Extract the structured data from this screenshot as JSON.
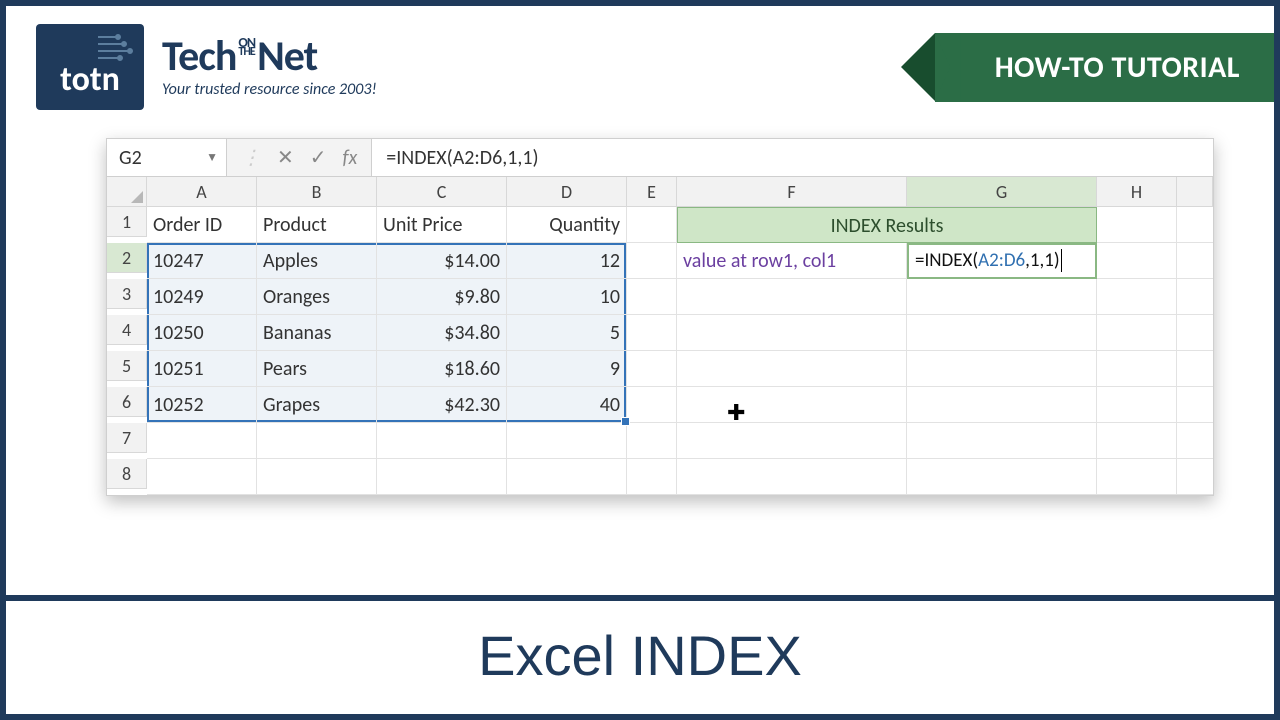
{
  "logo": {
    "box": "totn",
    "brand_pre": "Tech",
    "brand_on1": "ON",
    "brand_on2": "THE",
    "brand_post": "Net",
    "tagline": "Your trusted resource since 2003!"
  },
  "ribbon": {
    "label": "HOW-TO TUTORIAL"
  },
  "excel": {
    "namebox": "G2",
    "formula": "=INDEX(A2:D6,1,1)",
    "fx_label": "fx",
    "cols": [
      "A",
      "B",
      "C",
      "D",
      "E",
      "F",
      "G",
      "H"
    ],
    "rows": [
      "1",
      "2",
      "3",
      "4",
      "5",
      "6",
      "7",
      "8"
    ],
    "headers": {
      "A": "Order ID",
      "B": "Product",
      "C": "Unit Price",
      "D": "Quantity"
    },
    "data": [
      {
        "id": "10247",
        "product": "Apples",
        "price": "$14.00",
        "qty": "12"
      },
      {
        "id": "10249",
        "product": "Oranges",
        "price": "$9.80",
        "qty": "10"
      },
      {
        "id": "10250",
        "product": "Bananas",
        "price": "$34.80",
        "qty": "5"
      },
      {
        "id": "10251",
        "product": "Pears",
        "price": "$18.60",
        "qty": "9"
      },
      {
        "id": "10252",
        "product": "Grapes",
        "price": "$42.30",
        "qty": "40"
      }
    ],
    "results_header": "INDEX Results",
    "f2": "value at row1, col1",
    "g2_pre": "=INDEX(",
    "g2_ref": "A2:D6",
    "g2_post": ",1,1)"
  },
  "footer": {
    "title": "Excel INDEX"
  }
}
